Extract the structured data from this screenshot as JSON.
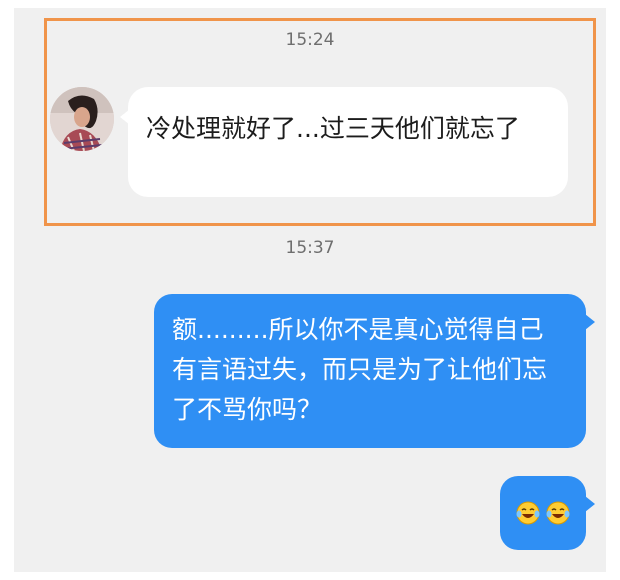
{
  "chat": {
    "messages": [
      {
        "time": "15:24",
        "direction": "incoming",
        "text": "冷处理就好了...过三天他们就忘了"
      },
      {
        "time": "15:37",
        "direction": "outgoing",
        "text": "额.........所以你不是真心觉得自己有言语过失，而只是为了让他们忘了不骂你吗？"
      },
      {
        "direction": "outgoing",
        "emoji": [
          "laughing-tears-emoji",
          "laughing-tears-emoji"
        ]
      }
    ]
  },
  "colors": {
    "chat_background": "#f0f0f0",
    "incoming_bubble": "#ffffff",
    "outgoing_bubble": "#2f8ff4",
    "highlight_border": "#f0944a",
    "timestamp_text": "#6e6e6e"
  }
}
